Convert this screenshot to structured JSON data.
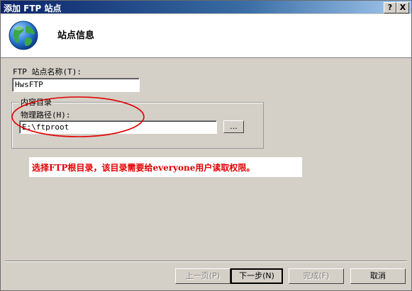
{
  "window": {
    "title": "添加 FTP 站点",
    "help_label": "?",
    "close_label": "X"
  },
  "header": {
    "title": "站点信息",
    "icon": "globe-icon"
  },
  "form": {
    "site_name_label": "FTP 站点名称(T):",
    "site_name_value": "HwsFTP",
    "content_group_label": "内容目录",
    "physical_path_label": "物理路径(H):",
    "physical_path_value": "E:\\ftproot",
    "browse_label": "..."
  },
  "annotation": {
    "text": "选择FTP根目录，该目录需要给everyone用户读取权限。",
    "color": "#e00000"
  },
  "buttons": {
    "prev": "上一页(P)",
    "next": "下一步(N)",
    "finish": "完成(F)",
    "cancel": "取消"
  }
}
